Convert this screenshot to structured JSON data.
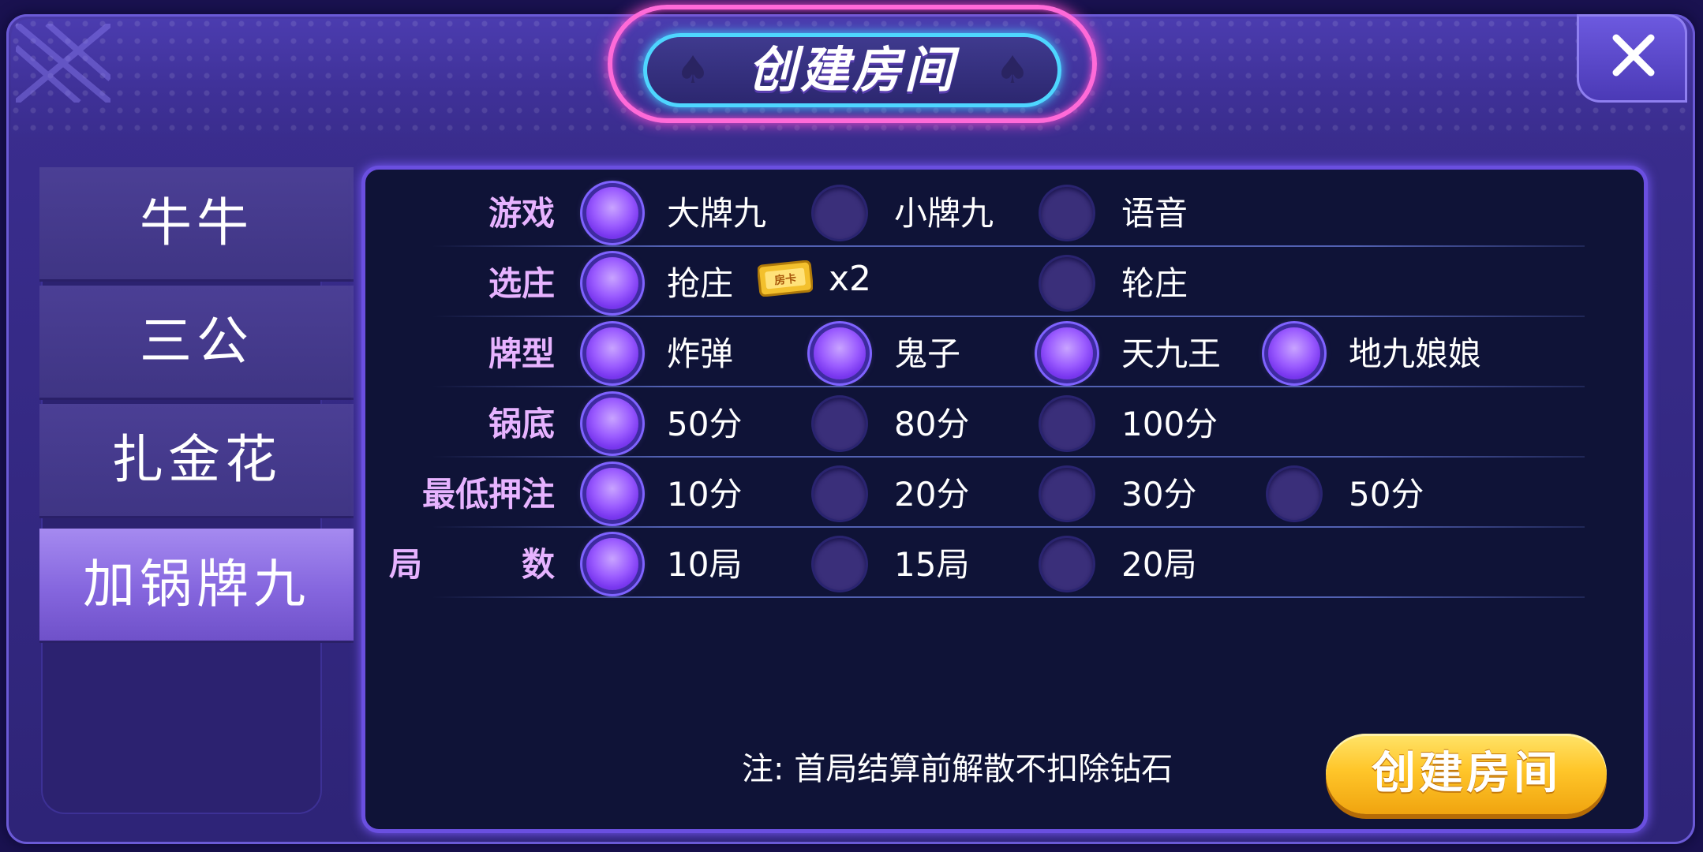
{
  "header": {
    "title": "创建房间",
    "close_icon": "close-icon",
    "spade_icon": "♠"
  },
  "sidebar": {
    "items": [
      {
        "label": "牛牛",
        "active": false
      },
      {
        "label": "三公",
        "active": false
      },
      {
        "label": "扎金花",
        "active": false
      },
      {
        "label": "加锅牌九",
        "active": true
      }
    ]
  },
  "settings": {
    "game": {
      "label": "游戏",
      "options": [
        {
          "label": "大牌九",
          "selected": true
        },
        {
          "label": "小牌九",
          "selected": false
        },
        {
          "label": "语音",
          "selected": false
        }
      ]
    },
    "banker": {
      "label": "选庄",
      "options": [
        {
          "label": "抢庄",
          "selected": true
        },
        {
          "label": "轮庄",
          "selected": false
        }
      ],
      "cost_icon": "room-card-icon",
      "cost_multiplier": "x2"
    },
    "card_type": {
      "label": "牌型",
      "options": [
        {
          "label": "炸弹",
          "selected": true
        },
        {
          "label": "鬼子",
          "selected": true
        },
        {
          "label": "天九王",
          "selected": true
        },
        {
          "label": "地九娘娘",
          "selected": true
        }
      ]
    },
    "pot_base": {
      "label": "锅底",
      "options": [
        {
          "label": "50分",
          "selected": true
        },
        {
          "label": "80分",
          "selected": false
        },
        {
          "label": "100分",
          "selected": false
        }
      ]
    },
    "min_bet": {
      "label": "最低押注",
      "options": [
        {
          "label": "10分",
          "selected": true
        },
        {
          "label": "20分",
          "selected": false
        },
        {
          "label": "30分",
          "selected": false
        },
        {
          "label": "50分",
          "selected": false
        }
      ]
    },
    "rounds": {
      "label_a": "局",
      "label_b": "数",
      "options": [
        {
          "label": "10局",
          "selected": true
        },
        {
          "label": "15局",
          "selected": false
        },
        {
          "label": "20局",
          "selected": false
        }
      ]
    }
  },
  "footer": {
    "note": "注: 首局结算前解散不扣除钻石",
    "create_button": "创建房间"
  },
  "colors": {
    "accent_purple": "#9b5cff",
    "label_pink": "#e7b3ff",
    "button_gold": "#ffc62a",
    "panel_bg": "#0f1337"
  }
}
